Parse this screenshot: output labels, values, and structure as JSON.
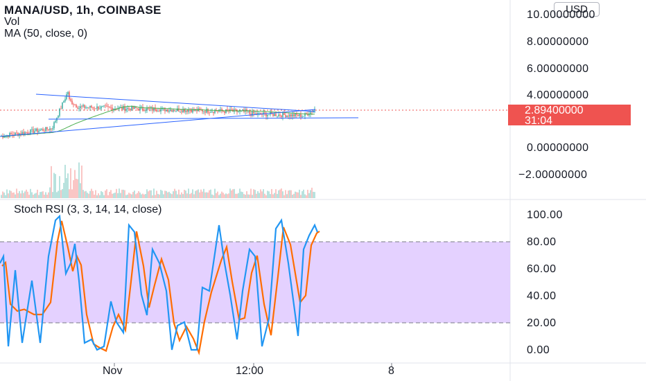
{
  "header": {
    "symbol_line": "MANA/USD, 1h, COINBASE",
    "vol_label": "Vol",
    "ma_label": "MA (50, close, 0)"
  },
  "currency_button": "USD",
  "price_axis": {
    "labels": [
      "10.00000000",
      "8.00000000",
      "6.00000000",
      "4.00000000",
      "0.00000000",
      "−2.00000000"
    ]
  },
  "current_price": {
    "value": "2.89400000",
    "countdown": "31:04",
    "color": "#ef5350"
  },
  "stoch_rsi": {
    "title": "Stoch RSI (3, 3, 14, 14, close)",
    "axis_labels": [
      "100.00",
      "80.00",
      "60.00",
      "40.00",
      "20.00",
      "0.00"
    ],
    "upper_band": 80,
    "lower_band": 20,
    "band_fill": "#e1ccff",
    "k_color": "#2196f3",
    "d_color": "#ff6d00"
  },
  "time_axis": {
    "labels": [
      "Nov",
      "12:00",
      "8"
    ]
  },
  "colors": {
    "up_candle": "#26a69a",
    "down_candle": "#ef5350",
    "ma_line": "#4caf50",
    "trend_line": "#2962ff"
  }
}
